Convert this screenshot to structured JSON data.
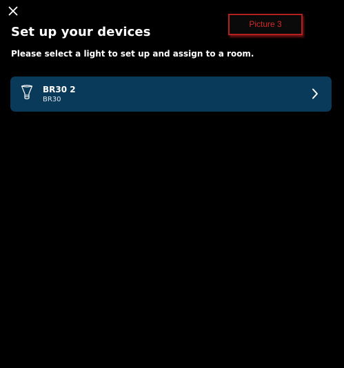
{
  "header": {
    "close_icon": "close-icon",
    "title": "Set up your devices",
    "subtitle": "Please select a light to set up and assign to a room."
  },
  "annotation": {
    "label": "Picture 3",
    "color": "#d42a2a"
  },
  "devices": [
    {
      "name": "BR30 2",
      "type": "BR30",
      "icon": "bulb-icon",
      "chevron": "chevron-right-icon"
    }
  ],
  "colors": {
    "background": "#000000",
    "card": "#0a3a5a",
    "text": "#ffffff"
  }
}
